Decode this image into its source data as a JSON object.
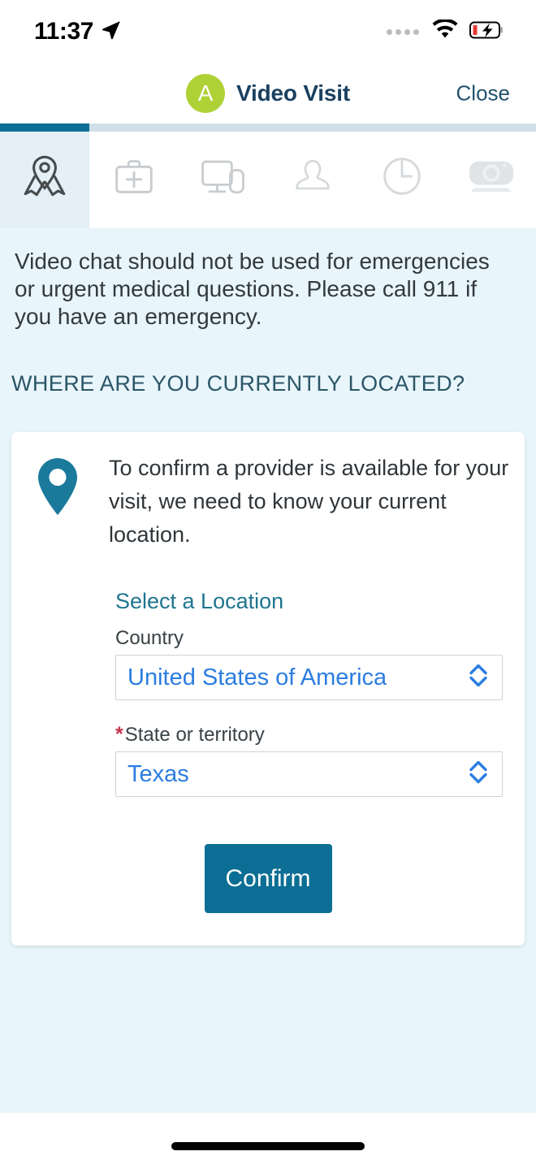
{
  "status_bar": {
    "time": "11:37",
    "location_icon": "location-arrow-icon",
    "signal_icon": "signal-dots-icon",
    "wifi_icon": "wifi-icon",
    "battery_icon": "battery-charging-low-icon"
  },
  "header": {
    "avatar_initial": "A",
    "avatar_color": "#aed136",
    "title": "Video Visit",
    "close_label": "Close"
  },
  "tabs": [
    {
      "name": "location",
      "icon": "map-pin-icon",
      "active": true
    },
    {
      "name": "medical-bag",
      "icon": "first-aid-kit-icon",
      "active": false
    },
    {
      "name": "devices",
      "icon": "monitor-phone-icon",
      "active": false
    },
    {
      "name": "person",
      "icon": "person-icon",
      "active": false
    },
    {
      "name": "clock",
      "icon": "clock-icon",
      "active": false
    },
    {
      "name": "camera",
      "icon": "webcam-icon",
      "active": false
    }
  ],
  "main": {
    "warning_text": "Video chat should not be used for emergencies or urgent medical questions.  Please call 911 if you have an emergency.",
    "section_title": "WHERE ARE YOU CURRENTLY LOCATED?"
  },
  "card": {
    "pin_icon": "map-pin-icon",
    "body_text": "To confirm a provider is available for your visit, we need to know your current location.",
    "select_location_link": "Select a Location",
    "country": {
      "label": "Country",
      "value": "United States of America",
      "required": false
    },
    "state": {
      "required_marker": "*",
      "label": "State or territory",
      "value": "Texas",
      "required": true
    },
    "confirm_label": "Confirm"
  },
  "colors": {
    "accent_teal": "#0c6e94",
    "page_background": "#e8f5fb",
    "link_blue": "#2b7de0",
    "required_red": "#c9344a",
    "title_navy": "#1b4060",
    "avatar_green": "#aed136"
  }
}
